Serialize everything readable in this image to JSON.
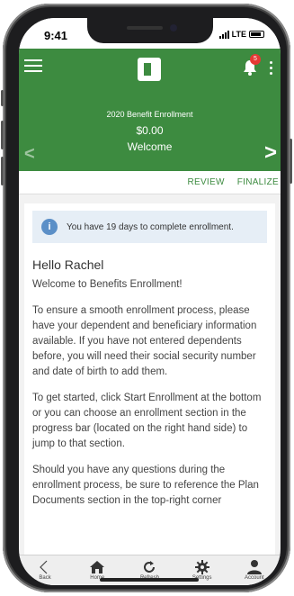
{
  "status_bar": {
    "time": "9:41",
    "carrier": "LTE"
  },
  "header": {
    "notification_count": "5",
    "subtitle": "2020 Benefit Enrollment",
    "amount": "$0.00",
    "title": "Welcome",
    "prev_arrow": "<",
    "next_arrow": ">"
  },
  "actions": {
    "review": "REVIEW",
    "finalize": "FINALIZE"
  },
  "info": {
    "icon": "i",
    "message": "You have 19 days to complete enrollment."
  },
  "content": {
    "greeting": "Hello Rachel",
    "welcome": "Welcome to Benefits Enrollment!",
    "para1": "To ensure a smooth enrollment process, please have your dependent and beneficiary information available. If you have not entered dependents before, you will need their social security number and date of birth to add them.",
    "para2": "To get started, click Start Enrollment at the bottom or you can choose an enrollment section in the progress bar (located on the right hand side) to jump to that section.",
    "para3": "Should you have any questions during the enrollment process, be sure to reference the Plan Documents section in the top-right corner"
  },
  "tabs": [
    {
      "label": "Back",
      "icon": "back-icon"
    },
    {
      "label": "Home",
      "icon": "home-icon"
    },
    {
      "label": "Refresh",
      "icon": "refresh-icon"
    },
    {
      "label": "Settings",
      "icon": "gear-icon"
    },
    {
      "label": "Account",
      "icon": "user-icon"
    }
  ],
  "colors": {
    "brand_green": "#3d8b40",
    "info_blue": "#5b8fc7",
    "badge_red": "#e53935"
  }
}
